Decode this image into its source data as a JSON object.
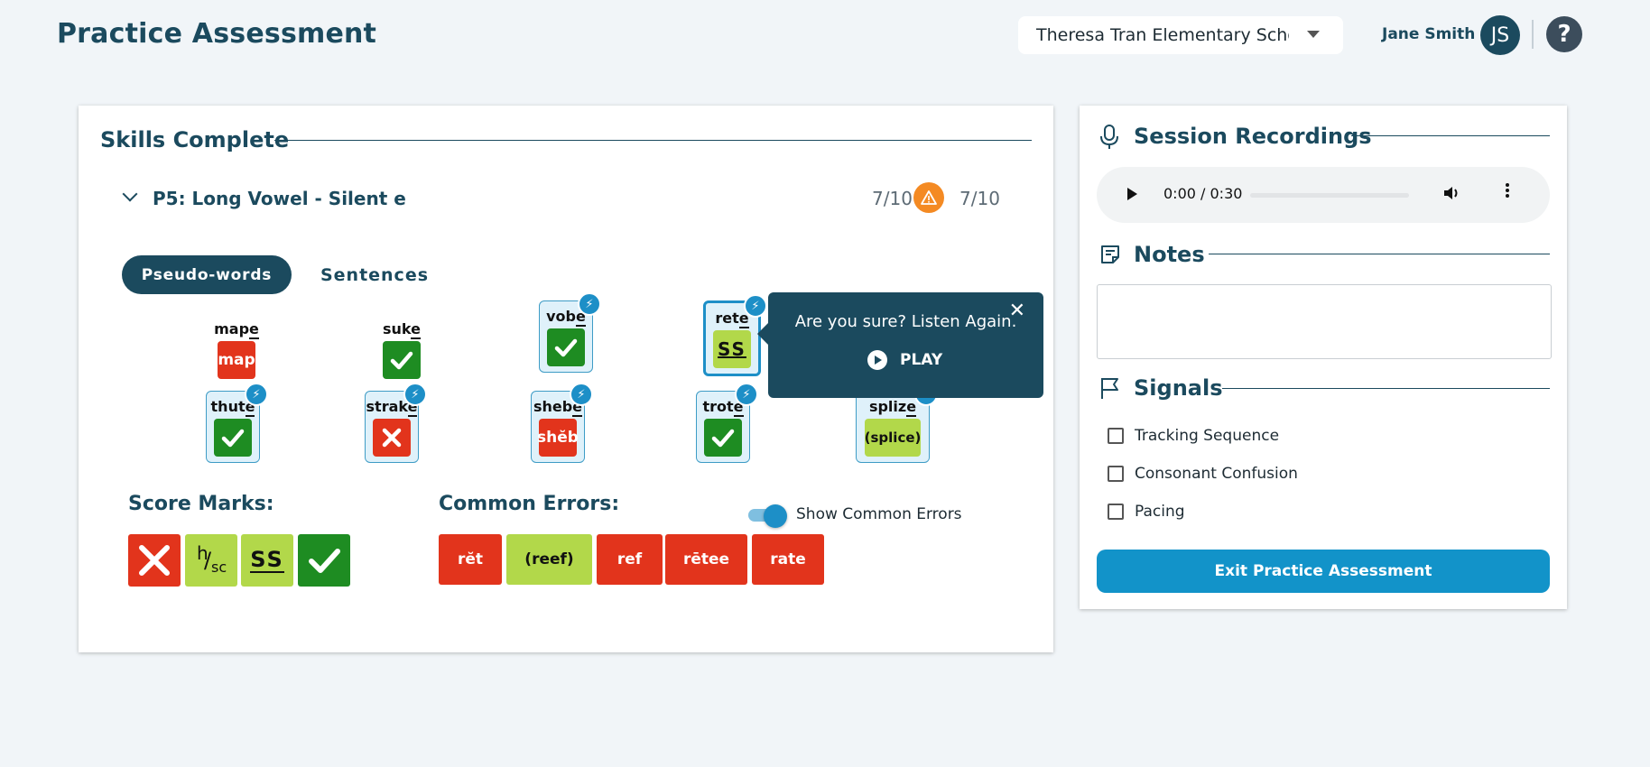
{
  "header": {
    "title": "Practice Assessment",
    "school": "Theresa Tran Elementary School",
    "user_name": "Jane Smith",
    "user_initials": "JS",
    "help_glyph": "?"
  },
  "main": {
    "section_title": "Skills Complete",
    "skill": {
      "title": "P5: Long Vowel - Silent e",
      "score_left": "7/10",
      "score_right": "7/10"
    },
    "tabs": [
      {
        "label": "Pseudo-words",
        "active": true
      },
      {
        "label": "Sentences",
        "active": false
      }
    ],
    "words": [
      {
        "pre": "map",
        "und": "e",
        "post": "",
        "mark": "map",
        "mark_type": "red",
        "boxed": false
      },
      {
        "pre": "suk",
        "und": "e",
        "post": "",
        "mark": "check",
        "mark_type": "green",
        "boxed": false
      },
      {
        "pre": "vob",
        "und": "e",
        "post": "",
        "mark": "check",
        "mark_type": "green",
        "boxed": true
      },
      {
        "pre": "ret",
        "und": "e",
        "post": "",
        "mark": "SS",
        "mark_type": "lime",
        "boxed": true,
        "selected": true
      },
      {
        "pre": "thut",
        "und": "e",
        "post": "",
        "mark": "check",
        "mark_type": "green",
        "boxed": true
      },
      {
        "pre": "strak",
        "und": "e",
        "post": "",
        "mark": "x",
        "mark_type": "red",
        "boxed": true
      },
      {
        "pre": "sheb",
        "und": "e",
        "post": "",
        "mark": "shĕb",
        "mark_type": "red",
        "boxed": true
      },
      {
        "pre": "trot",
        "und": "e",
        "post": "",
        "mark": "check",
        "mark_type": "green",
        "boxed": true
      },
      {
        "pre": "spliz",
        "und": "e",
        "post": "",
        "mark": "(splice)",
        "mark_type": "lime",
        "boxed": true
      }
    ],
    "popover": {
      "message": "Are you sure? Listen Again.",
      "play_label": "PLAY",
      "close_glyph": "✕"
    },
    "score_marks": {
      "label": "Score Marks:",
      "hsc_top": "h",
      "hsc_slash": "/",
      "hsc_bottom": "sc",
      "ss": "SS"
    },
    "common_errors": {
      "label": "Common Errors:",
      "toggle_label": "Show Common Errors",
      "toggle_on": true,
      "items": [
        {
          "text": "rĕt",
          "type": "red"
        },
        {
          "text": "(reef)",
          "type": "lime"
        },
        {
          "text": "ref",
          "type": "red"
        },
        {
          "text": "rētee",
          "type": "red"
        },
        {
          "text": "rate",
          "type": "red"
        }
      ]
    }
  },
  "side": {
    "recordings_title": "Session Recordings",
    "audio_time": "0:00 / 0:30",
    "notes_title": "Notes",
    "notes_value": "",
    "signals_title": "Signals",
    "signals": [
      "Tracking Sequence",
      "Consonant Confusion",
      "Pacing"
    ],
    "exit_label": "Exit Practice Assessment"
  },
  "colors": {
    "primary": "#1b4a5e",
    "accent": "#1293c9",
    "correct": "#1e8c22",
    "error": "#e2341c",
    "self_correct": "#b2d84a",
    "warning": "#f48a23"
  }
}
